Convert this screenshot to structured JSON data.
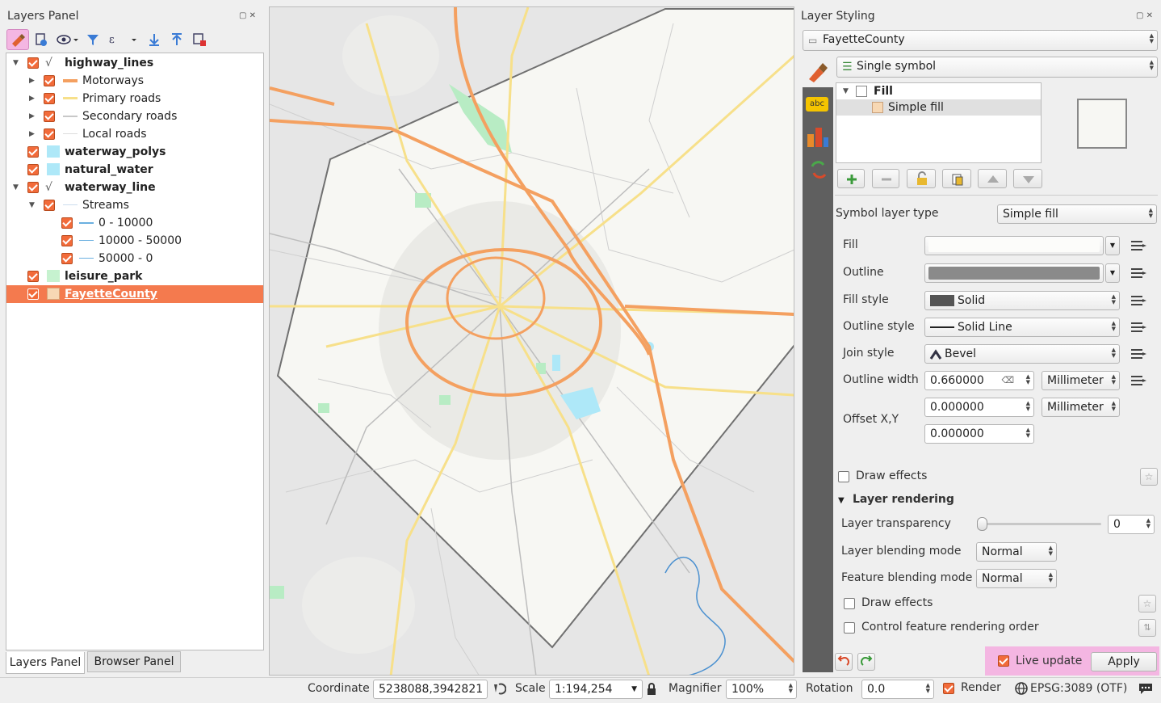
{
  "layers_panel": {
    "title": "Layers Panel",
    "tree": [
      {
        "label": "highway_lines",
        "bold": true
      },
      {
        "label": "Motorways"
      },
      {
        "label": "Primary roads"
      },
      {
        "label": "Secondary roads"
      },
      {
        "label": "Local roads"
      },
      {
        "label": "waterway_polys",
        "bold": true
      },
      {
        "label": "natural_water",
        "bold": true
      },
      {
        "label": "waterway_line",
        "bold": true
      },
      {
        "label": "Streams"
      },
      {
        "label": "0 - 10000"
      },
      {
        "label": "10000 - 50000"
      },
      {
        "label": "50000 - 0"
      },
      {
        "label": "leisure_park",
        "bold": true
      },
      {
        "label": "FayetteCounty",
        "bold": true,
        "selected": true
      }
    ],
    "tabs": [
      "Layers Panel",
      "Browser Panel"
    ]
  },
  "styling": {
    "title": "Layer Styling",
    "layer": "FayetteCounty",
    "renderer": "Single symbol",
    "symbol_tree": [
      "Fill",
      "Simple fill"
    ],
    "symbol_layer_type_label": "Symbol layer type",
    "symbol_layer_type": "Simple fill",
    "fill_label": "Fill",
    "outline_label": "Outline",
    "fill_style_label": "Fill style",
    "fill_style": "Solid",
    "outline_style_label": "Outline style",
    "outline_style": "Solid Line",
    "join_style_label": "Join style",
    "join_style": "Bevel",
    "outline_width_label": "Outline width",
    "outline_width": "0.660000",
    "outline_width_unit": "Millimeter",
    "offset_label": "Offset X,Y",
    "offset_x": "0.000000",
    "offset_y": "0.000000",
    "offset_unit": "Millimeter",
    "draw_effects": "Draw effects",
    "layer_rendering": "Layer rendering",
    "transparency_label": "Layer transparency",
    "transparency": "0",
    "layer_blending_label": "Layer blending mode",
    "layer_blending": "Normal",
    "feature_blending_label": "Feature blending mode",
    "feature_blending": "Normal",
    "draw_effects2": "Draw effects",
    "control_order": "Control feature rendering order",
    "live_update": "Live update",
    "apply": "Apply",
    "side_icon_label": "abc"
  },
  "status": {
    "coordinate_label": "Coordinate",
    "coordinate": "5238088,3942821",
    "scale_label": "Scale",
    "scale": "1:194,254",
    "magnifier_label": "Magnifier",
    "magnifier": "100%",
    "rotation_label": "Rotation",
    "rotation": "0.0",
    "render_label": "Render",
    "crs": "EPSG:3089 (OTF)"
  },
  "colors": {
    "accent": "#f26b3a",
    "selected_row": "#f47a4e",
    "motorway": "#f4a060",
    "primary": "#f7e08a",
    "secondary": "#c8c8c8",
    "stream": "#6ab0e0",
    "water": "#aee8f8",
    "park": "#c6f2cf",
    "county_fill": "#f7d8b4",
    "live_bg": "#f4b6e2"
  }
}
